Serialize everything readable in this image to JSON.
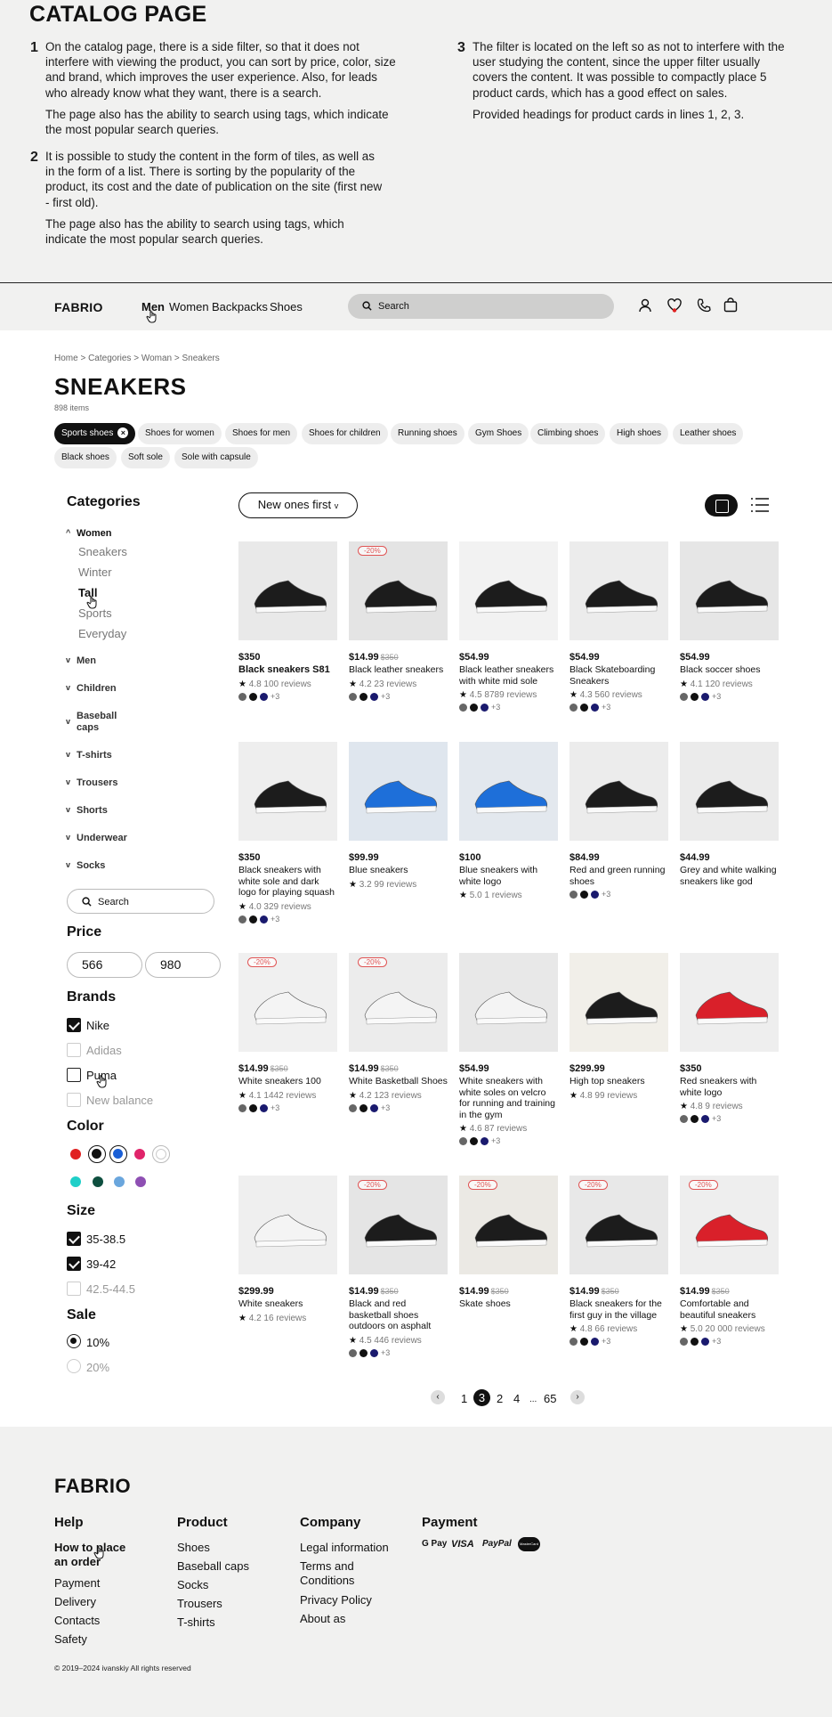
{
  "description": {
    "title": "CATALOG PAGE",
    "notes": [
      {
        "num": "1",
        "p1": "On the catalog page, there is a side filter, so that it does not interfere with viewing the product, you can sort by price, color, size and brand, which improves the user experience. Also, for leads who already know what they want, there is a search.",
        "p2": "The page also has the ability to search using tags, which indicate the most popular search queries."
      },
      {
        "num": "2",
        "p1": "It is possible to study the content in the form of tiles, as well as in the form of a list. There is sorting by the popularity of the product, its cost and the date of publication on the site (first new - first old).",
        "p2": "The page also has the ability to search using tags, which indicate the most popular search queries."
      },
      {
        "num": "3",
        "p1": "The filter is located on the left so as not to interfere with the user studying the content, since the upper filter usually covers the content. It was possible to compactly place 5 product cards, which has a good effect on sales.",
        "p2": "Provided headings for product cards in lines 1, 2, 3."
      }
    ]
  },
  "header": {
    "logo": "FABRIO",
    "nav": [
      "Men",
      "Women",
      "Backpacks",
      "Shoes"
    ],
    "search_placeholder": "Search",
    "icons": [
      "user-icon",
      "heart-icon",
      "phone-icon",
      "bag-icon"
    ]
  },
  "breadcrumb": "Home > Categories > Woman > Sneakers",
  "page_title": "SNEAKERS",
  "item_count": "898 items",
  "tags": [
    "Sports shoes",
    "Shoes for women",
    "Shoes for men",
    "Shoes for children",
    "Running shoes",
    "Gym Shoes",
    "Climbing shoes",
    "High shoes",
    "Leather shoes",
    "Black shoes",
    "Soft sole",
    "Sole with capsule"
  ],
  "sidebar": {
    "categories_title": "Categories",
    "women_label": "Women",
    "women_subs": [
      "Sneakers",
      "Winter",
      "Tall",
      "Sports",
      "Everyday"
    ],
    "other_categories": [
      "Men",
      "Children",
      "Baseball caps",
      "T-shirts",
      "Trousers",
      "Shorts",
      "Underwear",
      "Socks"
    ],
    "search_placeholder": "Search",
    "price_title": "Price",
    "price_min": "566",
    "price_max": "980",
    "brands_title": "Brands",
    "brands": [
      {
        "label": "Nike",
        "state": "checked"
      },
      {
        "label": "Adidas",
        "state": "disabled"
      },
      {
        "label": "Puma",
        "state": "unchecked"
      },
      {
        "label": "New balance",
        "state": "disabled"
      }
    ],
    "color_title": "Color",
    "colors": [
      "#e02020",
      "#111111",
      "#1a5fd6",
      "#e0246a",
      "#ffffff",
      "#1fcfc8",
      "#0e4f3f",
      "#6aa6dd",
      "#8e4fb3"
    ],
    "size_title": "Size",
    "sizes": [
      {
        "label": "35-38.5",
        "state": "checked"
      },
      {
        "label": "39-42",
        "state": "checked"
      },
      {
        "label": "42.5-44.5",
        "state": "disabled"
      }
    ],
    "sale_title": "Sale",
    "sales": [
      {
        "label": "10%",
        "state": "selected"
      },
      {
        "label": "20%",
        "state": "disabled"
      }
    ]
  },
  "sort_label": "New ones first",
  "products": [
    {
      "price": "$350",
      "old": "",
      "name": "Black sneakers S81",
      "rating": "4.8",
      "reviews": "100 reviews",
      "badge": "",
      "more": "+3",
      "img": "#e9e9e9"
    },
    {
      "price": "$14.99",
      "old": "$350",
      "name": "Black leather sneakers",
      "rating": "4.2",
      "reviews": "23 reviews",
      "badge": "-20%",
      "more": "+3",
      "img": "#e4e4e4"
    },
    {
      "price": "$54.99",
      "old": "",
      "name": "Black leather sneakers with white mid sole",
      "rating": "4.5",
      "reviews": "8789 reviews",
      "badge": "",
      "more": "+3",
      "img": "#f2f2f2"
    },
    {
      "price": "$54.99",
      "old": "",
      "name": "Black Skateboarding Sneakers",
      "rating": "4.3",
      "reviews": "560 reviews",
      "badge": "",
      "more": "+3",
      "img": "#ececec"
    },
    {
      "price": "$54.99",
      "old": "",
      "name": "Black soccer shoes",
      "rating": "4.1",
      "reviews": "120 reviews",
      "badge": "",
      "more": "+3",
      "img": "#e6e6e6"
    },
    {
      "price": "$350",
      "old": "",
      "name": "Black sneakers with white sole and dark logo for playing squash",
      "rating": "4.0",
      "reviews": "329 reviews",
      "badge": "",
      "more": "+3",
      "img": "#eeeeee"
    },
    {
      "price": "$99.99",
      "old": "",
      "name": "Blue sneakers",
      "rating": "3.2",
      "reviews": "99 reviews",
      "badge": "",
      "more": "",
      "img": "#dfe6ee"
    },
    {
      "price": "$100",
      "old": "",
      "name": "Blue sneakers with white logo",
      "rating": "5.0",
      "reviews": "1 reviews",
      "badge": "",
      "more": "",
      "img": "#e3e8ee"
    },
    {
      "price": "$84.99",
      "old": "",
      "name": "Red and green running shoes",
      "rating": "",
      "reviews": "",
      "badge": "",
      "more": "+3",
      "img": "#ececec"
    },
    {
      "price": "$44.99",
      "old": "",
      "name": "Grey and white walking sneakers like god",
      "rating": "",
      "reviews": "",
      "badge": "",
      "more": "",
      "img": "#ebebeb"
    },
    {
      "price": "$14.99",
      "old": "$350",
      "name": "White sneakers 100",
      "rating": "4.1",
      "reviews": "1442 reviews",
      "badge": "-20%",
      "more": "+3",
      "img": "#f0f0f0"
    },
    {
      "price": "$14.99",
      "old": "$350",
      "name": "White Basketball Shoes",
      "rating": "4.2",
      "reviews": "123 reviews",
      "badge": "-20%",
      "more": "+3",
      "img": "#ececec"
    },
    {
      "price": "$54.99",
      "old": "",
      "name": "White sneakers with white soles on velcro for running and training in the gym",
      "rating": "4.6",
      "reviews": "87 reviews",
      "badge": "",
      "more": "+3",
      "img": "#e8e8e8"
    },
    {
      "price": "$299.99",
      "old": "",
      "name": "High top sneakers",
      "rating": "4.8",
      "reviews": "99 reviews",
      "badge": "",
      "more": "",
      "img": "#f1efe9"
    },
    {
      "price": "$350",
      "old": "",
      "name": "Red sneakers with white logo",
      "rating": "4.8",
      "reviews": "9 reviews",
      "badge": "",
      "more": "+3",
      "img": "#eeeeee"
    },
    {
      "price": "$299.99",
      "old": "",
      "name": "White sneakers",
      "rating": "4.2",
      "reviews": "16 reviews",
      "badge": "",
      "more": "",
      "img": "#efefef"
    },
    {
      "price": "$14.99",
      "old": "$350",
      "name": "Black and red basketball shoes outdoors on asphalt",
      "rating": "4.5",
      "reviews": "446 reviews",
      "badge": "-20%",
      "more": "+3",
      "img": "#e5e5e5"
    },
    {
      "price": "$14.99",
      "old": "$350",
      "name": "Skate shoes",
      "rating": "",
      "reviews": "",
      "badge": "-20%",
      "more": "",
      "img": "#ebe9e4"
    },
    {
      "price": "$14.99",
      "old": "$350",
      "name": "Black sneakers for the first guy in the village",
      "rating": "4.8",
      "reviews": "66 reviews",
      "badge": "-20%",
      "more": "+3",
      "img": "#e8e8e8"
    },
    {
      "price": "$14.99",
      "old": "$350",
      "name": "Comfortable and beautiful sneakers",
      "rating": "5.0",
      "reviews": "20 000 reviews",
      "badge": "-20%",
      "more": "+3",
      "img": "#eeeeee"
    }
  ],
  "pagination": {
    "pages": [
      "1",
      "3",
      "2",
      "4",
      "...",
      "65"
    ]
  },
  "footer": {
    "logo": "FABRIO",
    "help_title": "Help",
    "help_links": [
      "How to place an order",
      "Payment",
      "Delivery",
      "Contacts",
      "Safety"
    ],
    "product_title": "Product",
    "product_links": [
      "Shoes",
      "Baseball caps",
      "Socks",
      "Trousers",
      "T-shirts"
    ],
    "company_title": "Company",
    "company_links": [
      "Legal information",
      "Terms and Conditions",
      "Privacy Policy",
      "About as"
    ],
    "payment_title": "Payment",
    "payment_methods": [
      "G Pay",
      "VISA",
      "PayPal",
      "MasterCard"
    ],
    "copyright": "© 2019–2024 ivanskiy All rights reserved"
  }
}
